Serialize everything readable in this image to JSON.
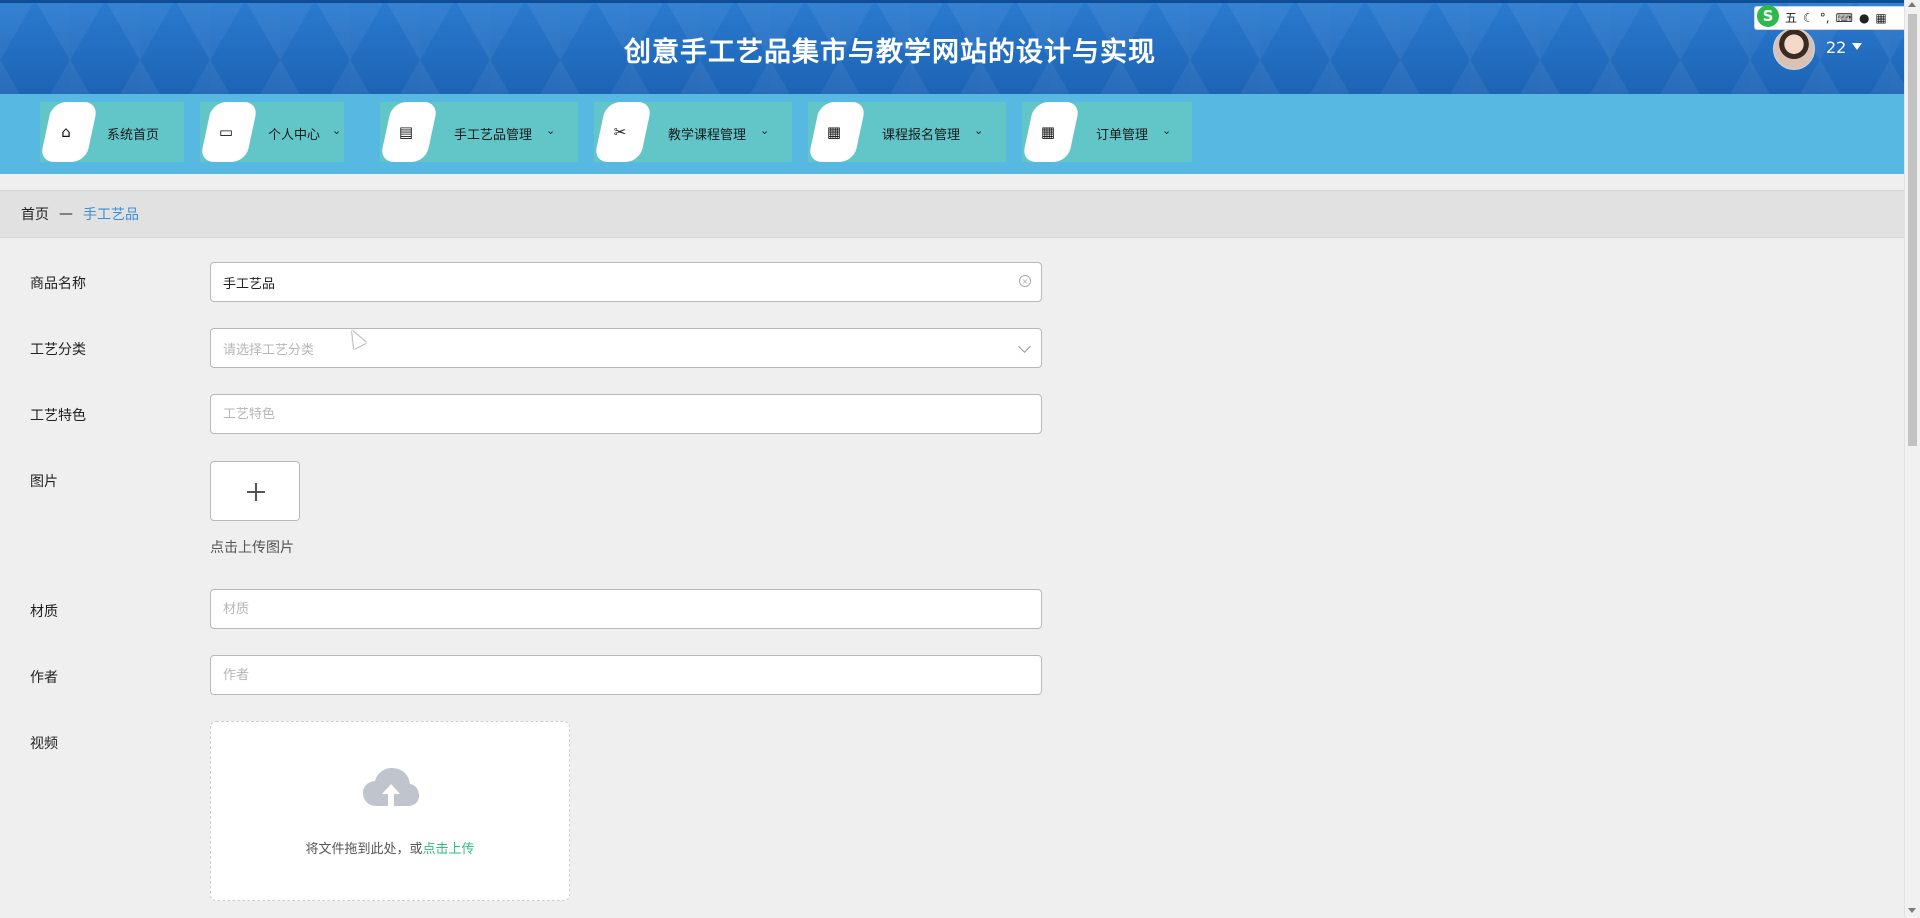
{
  "header": {
    "title": "创意手工艺品集市与教学网站的设计与实现",
    "user_name": "22",
    "brand_color": "#1f6fc0"
  },
  "ime_toolbar": {
    "logo": "S",
    "mode": "五",
    "icons": [
      "moon-icon",
      "punctuation-icon",
      "keyboard-icon",
      "user-icon",
      "grid-icon"
    ]
  },
  "nav": {
    "background": "#57b9e2",
    "items": [
      {
        "label": "系统首页",
        "icon": "home-icon",
        "has_dropdown": false
      },
      {
        "label": "个人中心",
        "icon": "wallet-icon",
        "has_dropdown": true
      },
      {
        "label": "手工艺品管理",
        "icon": "clipboard-icon",
        "has_dropdown": true
      },
      {
        "label": "教学课程管理",
        "icon": "ticket-icon",
        "has_dropdown": true
      },
      {
        "label": "课程报名管理",
        "icon": "grid-icon",
        "has_dropdown": true
      },
      {
        "label": "订单管理",
        "icon": "grid-icon",
        "has_dropdown": true
      }
    ]
  },
  "breadcrumb": {
    "home": "首页",
    "separator": "—",
    "current": "手工艺品"
  },
  "form": {
    "product_name": {
      "label": "商品名称",
      "value": "手工艺品"
    },
    "category": {
      "label": "工艺分类",
      "placeholder": "请选择工艺分类"
    },
    "feature": {
      "label": "工艺特色",
      "placeholder": "工艺特色"
    },
    "image": {
      "label": "图片",
      "hint": "点击上传图片"
    },
    "material": {
      "label": "材质",
      "placeholder": "材质"
    },
    "author": {
      "label": "作者",
      "placeholder": "作者"
    },
    "video": {
      "label": "视频",
      "drop_text": "将文件拖到此处，或",
      "drop_link": "点击上传"
    }
  }
}
